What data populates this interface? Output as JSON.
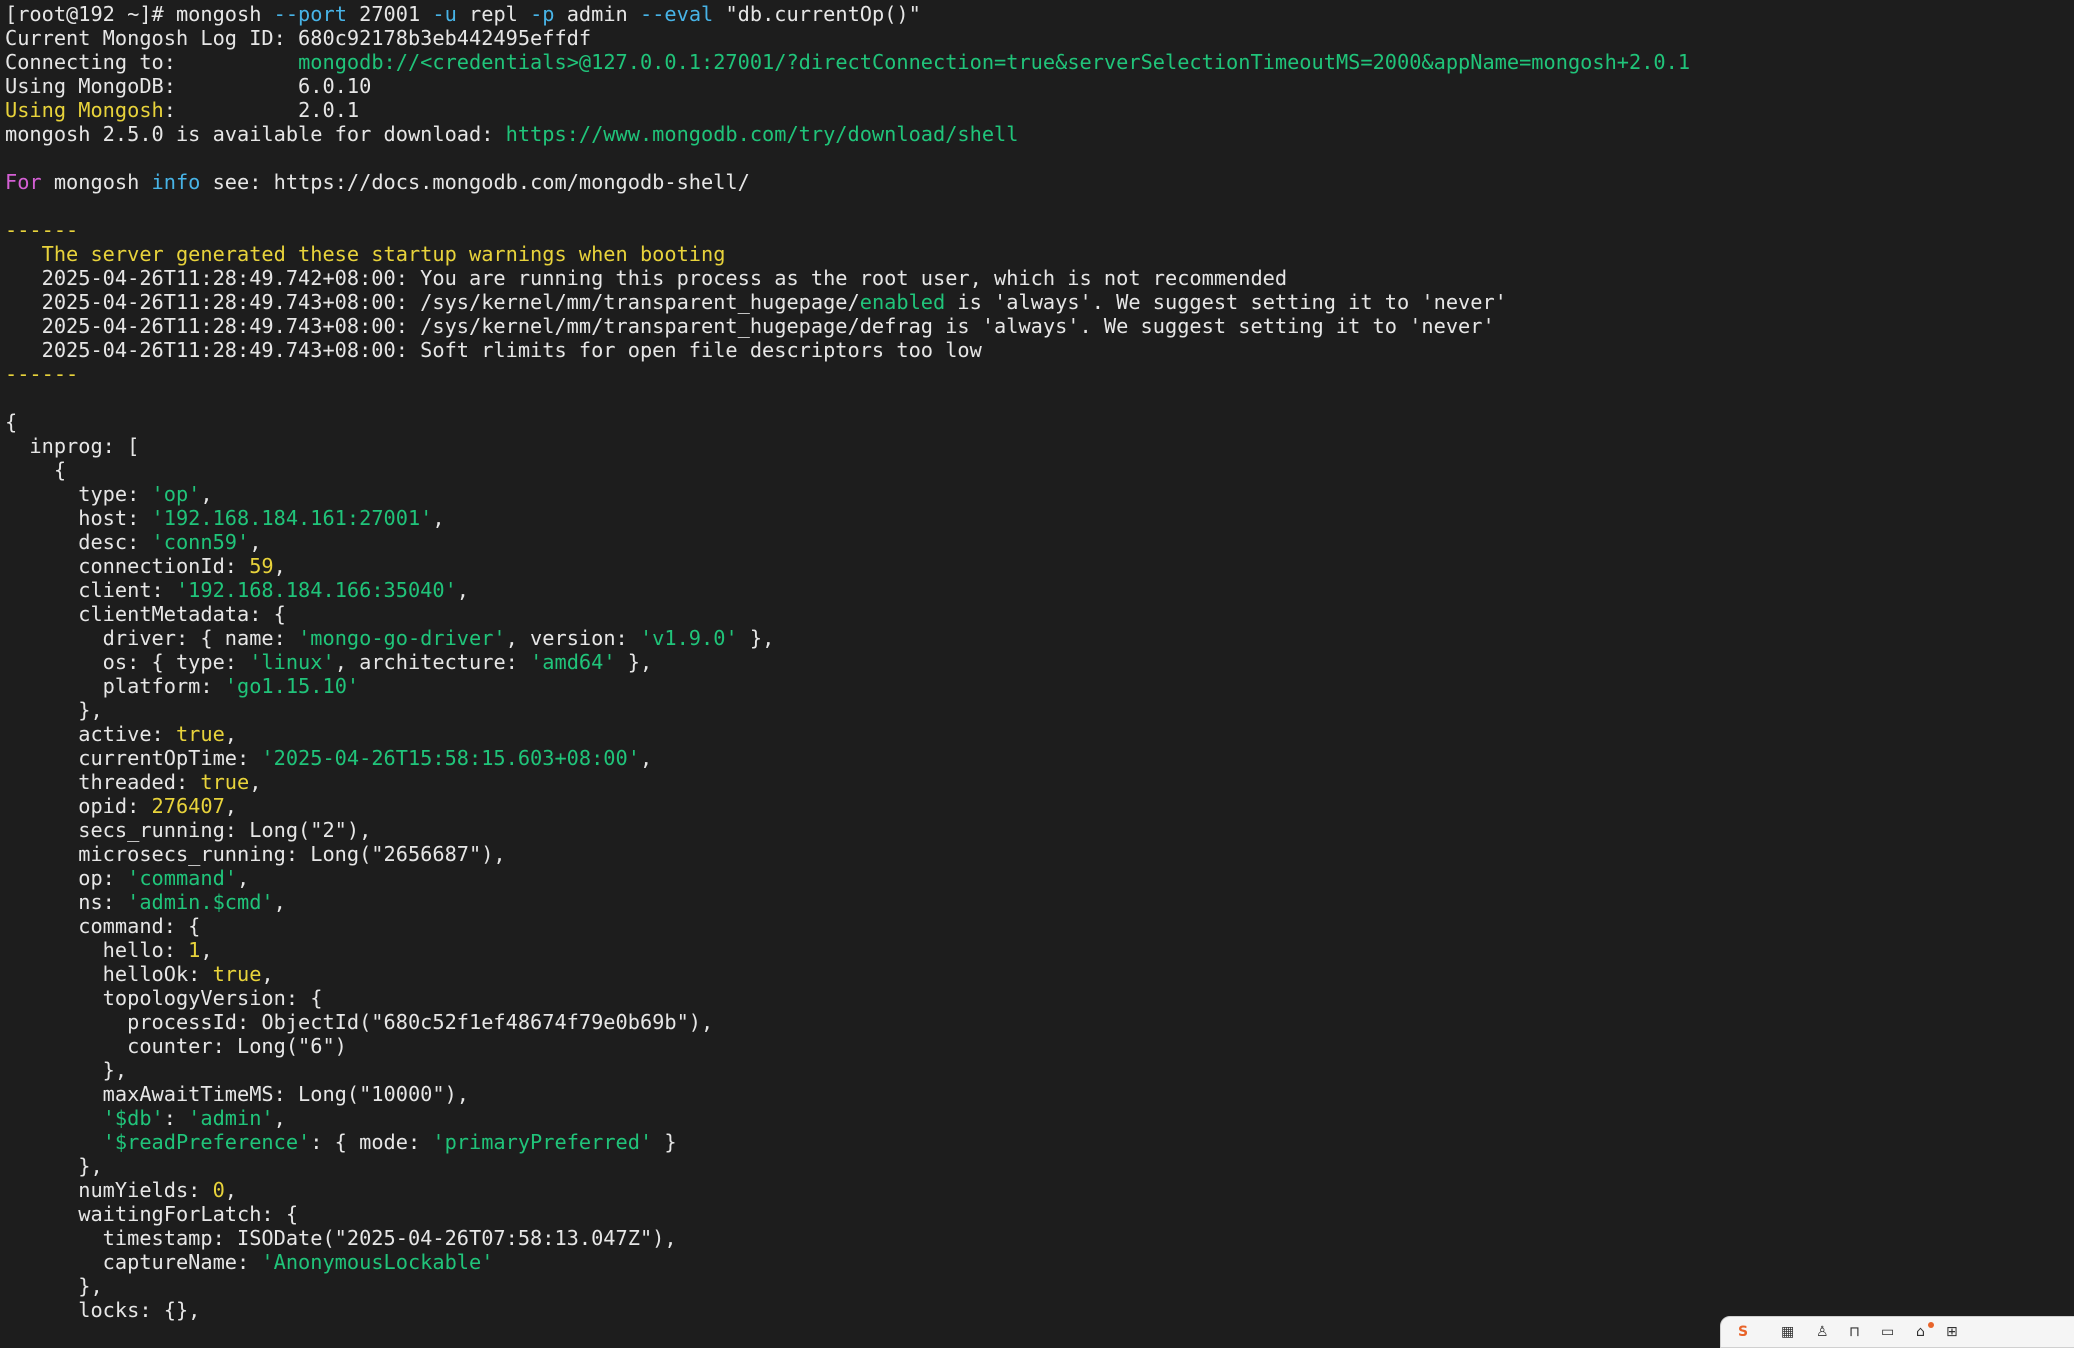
{
  "terminal": {
    "colors": {
      "background": "#1d1d1d",
      "default": "#e6e6e6",
      "green": "#20c47a",
      "yellow": "#e8d33b",
      "cyan": "#47b3e6",
      "magenta": "#d45fd4"
    },
    "lines": [
      [
        [
          "w",
          "[root@192 ~]# mongosh "
        ],
        [
          "c",
          "--port"
        ],
        [
          "w",
          " 27001 "
        ],
        [
          "c",
          "-u"
        ],
        [
          "w",
          " repl "
        ],
        [
          "c",
          "-p"
        ],
        [
          "w",
          " admin "
        ],
        [
          "c",
          "--eval"
        ],
        [
          "w",
          " \"db.currentOp()\""
        ]
      ],
      [
        [
          "w",
          "Current Mongosh Log ID: 680c92178b3eb442495effdf"
        ]
      ],
      [
        [
          "w",
          "Connecting to:          "
        ],
        [
          "g",
          "mongodb://<credentials>@127.0.0.1:27001/?directConnection=true&serverSelectionTimeoutMS=2000&appName=mongosh+2.0.1"
        ]
      ],
      [
        [
          "w",
          "Using MongoDB:          6.0.10"
        ]
      ],
      [
        [
          "y",
          "Using Mongosh"
        ],
        [
          "w",
          ":          2.0.1"
        ]
      ],
      [
        [
          "w",
          "mongosh 2.5.0 is available for download: "
        ],
        [
          "g",
          "https://www.mongodb.com/try/download/shell"
        ]
      ],
      [],
      [
        [
          "m",
          "For"
        ],
        [
          "w",
          " mongosh "
        ],
        [
          "c",
          "info"
        ],
        [
          "w",
          " see: https://docs.mongodb.com/mongodb-shell/"
        ]
      ],
      [],
      [
        [
          "y",
          "------"
        ]
      ],
      [
        [
          "y",
          "   The server generated these startup warnings when booting"
        ]
      ],
      [
        [
          "w",
          "   2025-04-26T11:28:49.742+08:00: You are running this process as the root user, which is not recommended"
        ]
      ],
      [
        [
          "w",
          "   2025-04-26T11:28:49.743+08:00: /sys/kernel/mm/transparent_hugepage/"
        ],
        [
          "g",
          "enabled"
        ],
        [
          "w",
          " is 'always'. We suggest setting it to 'never'"
        ]
      ],
      [
        [
          "w",
          "   2025-04-26T11:28:49.743+08:00: /sys/kernel/mm/transparent_hugepage/defrag is 'always'. We suggest setting it to 'never'"
        ]
      ],
      [
        [
          "w",
          "   2025-04-26T11:28:49.743+08:00: Soft rlimits for open file descriptors too low"
        ]
      ],
      [
        [
          "y",
          "------"
        ]
      ],
      [],
      [
        [
          "w",
          "{"
        ]
      ],
      [
        [
          "w",
          "  inprog: ["
        ]
      ],
      [
        [
          "w",
          "    {"
        ]
      ],
      [
        [
          "w",
          "      type: "
        ],
        [
          "g",
          "'op'"
        ],
        [
          "w",
          ","
        ]
      ],
      [
        [
          "w",
          "      host: "
        ],
        [
          "g",
          "'192.168.184.161:27001'"
        ],
        [
          "w",
          ","
        ]
      ],
      [
        [
          "w",
          "      desc: "
        ],
        [
          "g",
          "'conn59'"
        ],
        [
          "w",
          ","
        ]
      ],
      [
        [
          "w",
          "      connectionId: "
        ],
        [
          "y",
          "59"
        ],
        [
          "w",
          ","
        ]
      ],
      [
        [
          "w",
          "      client: "
        ],
        [
          "g",
          "'192.168.184.166:35040'"
        ],
        [
          "w",
          ","
        ]
      ],
      [
        [
          "w",
          "      clientMetadata: {"
        ]
      ],
      [
        [
          "w",
          "        driver: { name: "
        ],
        [
          "g",
          "'mongo-go-driver'"
        ],
        [
          "w",
          ", version: "
        ],
        [
          "g",
          "'v1.9.0'"
        ],
        [
          "w",
          " },"
        ]
      ],
      [
        [
          "w",
          "        os: { type: "
        ],
        [
          "g",
          "'linux'"
        ],
        [
          "w",
          ", architecture: "
        ],
        [
          "g",
          "'amd64'"
        ],
        [
          "w",
          " },"
        ]
      ],
      [
        [
          "w",
          "        platform: "
        ],
        [
          "g",
          "'go1.15.10'"
        ]
      ],
      [
        [
          "w",
          "      },"
        ]
      ],
      [
        [
          "w",
          "      active: "
        ],
        [
          "y",
          "true"
        ],
        [
          "w",
          ","
        ]
      ],
      [
        [
          "w",
          "      currentOpTime: "
        ],
        [
          "g",
          "'2025-04-26T15:58:15.603+08:00'"
        ],
        [
          "w",
          ","
        ]
      ],
      [
        [
          "w",
          "      threaded: "
        ],
        [
          "y",
          "true"
        ],
        [
          "w",
          ","
        ]
      ],
      [
        [
          "w",
          "      opid: "
        ],
        [
          "y",
          "276407"
        ],
        [
          "w",
          ","
        ]
      ],
      [
        [
          "w",
          "      secs_running: Long(\"2\"),"
        ]
      ],
      [
        [
          "w",
          "      microsecs_running: Long(\"2656687\"),"
        ]
      ],
      [
        [
          "w",
          "      op: "
        ],
        [
          "g",
          "'command'"
        ],
        [
          "w",
          ","
        ]
      ],
      [
        [
          "w",
          "      ns: "
        ],
        [
          "g",
          "'admin.$cmd'"
        ],
        [
          "w",
          ","
        ]
      ],
      [
        [
          "w",
          "      command: {"
        ]
      ],
      [
        [
          "w",
          "        hello: "
        ],
        [
          "y",
          "1"
        ],
        [
          "w",
          ","
        ]
      ],
      [
        [
          "w",
          "        helloOk: "
        ],
        [
          "y",
          "true"
        ],
        [
          "w",
          ","
        ]
      ],
      [
        [
          "w",
          "        topologyVersion: {"
        ]
      ],
      [
        [
          "w",
          "          processId: ObjectId(\"680c52f1ef48674f79e0b69b\"),"
        ]
      ],
      [
        [
          "w",
          "          counter: Long(\"6\")"
        ]
      ],
      [
        [
          "w",
          "        },"
        ]
      ],
      [
        [
          "w",
          "        maxAwaitTimeMS: Long(\"10000\"),"
        ]
      ],
      [
        [
          "w",
          "        "
        ],
        [
          "g",
          "'$db'"
        ],
        [
          "w",
          ": "
        ],
        [
          "g",
          "'admin'"
        ],
        [
          "w",
          ","
        ]
      ],
      [
        [
          "w",
          "        "
        ],
        [
          "g",
          "'$readPreference'"
        ],
        [
          "w",
          ": { mode: "
        ],
        [
          "g",
          "'primaryPreferred'"
        ],
        [
          "w",
          " }"
        ]
      ],
      [
        [
          "w",
          "      },"
        ]
      ],
      [
        [
          "w",
          "      numYields: "
        ],
        [
          "y",
          "0"
        ],
        [
          "w",
          ","
        ]
      ],
      [
        [
          "w",
          "      waitingForLatch: {"
        ]
      ],
      [
        [
          "w",
          "        timestamp: ISODate(\"2025-04-26T07:58:13.047Z\"),"
        ]
      ],
      [
        [
          "w",
          "        captureName: "
        ],
        [
          "g",
          "'AnonymousLockable'"
        ]
      ],
      [
        [
          "w",
          "      },"
        ]
      ],
      [
        [
          "w",
          "      locks: {},"
        ]
      ]
    ]
  },
  "tray": {
    "icons": [
      "ime-icon",
      "calendar-icon",
      "person-icon",
      "lock-icon",
      "keyboard-icon",
      "shirt-icon",
      "grid-icon"
    ]
  }
}
